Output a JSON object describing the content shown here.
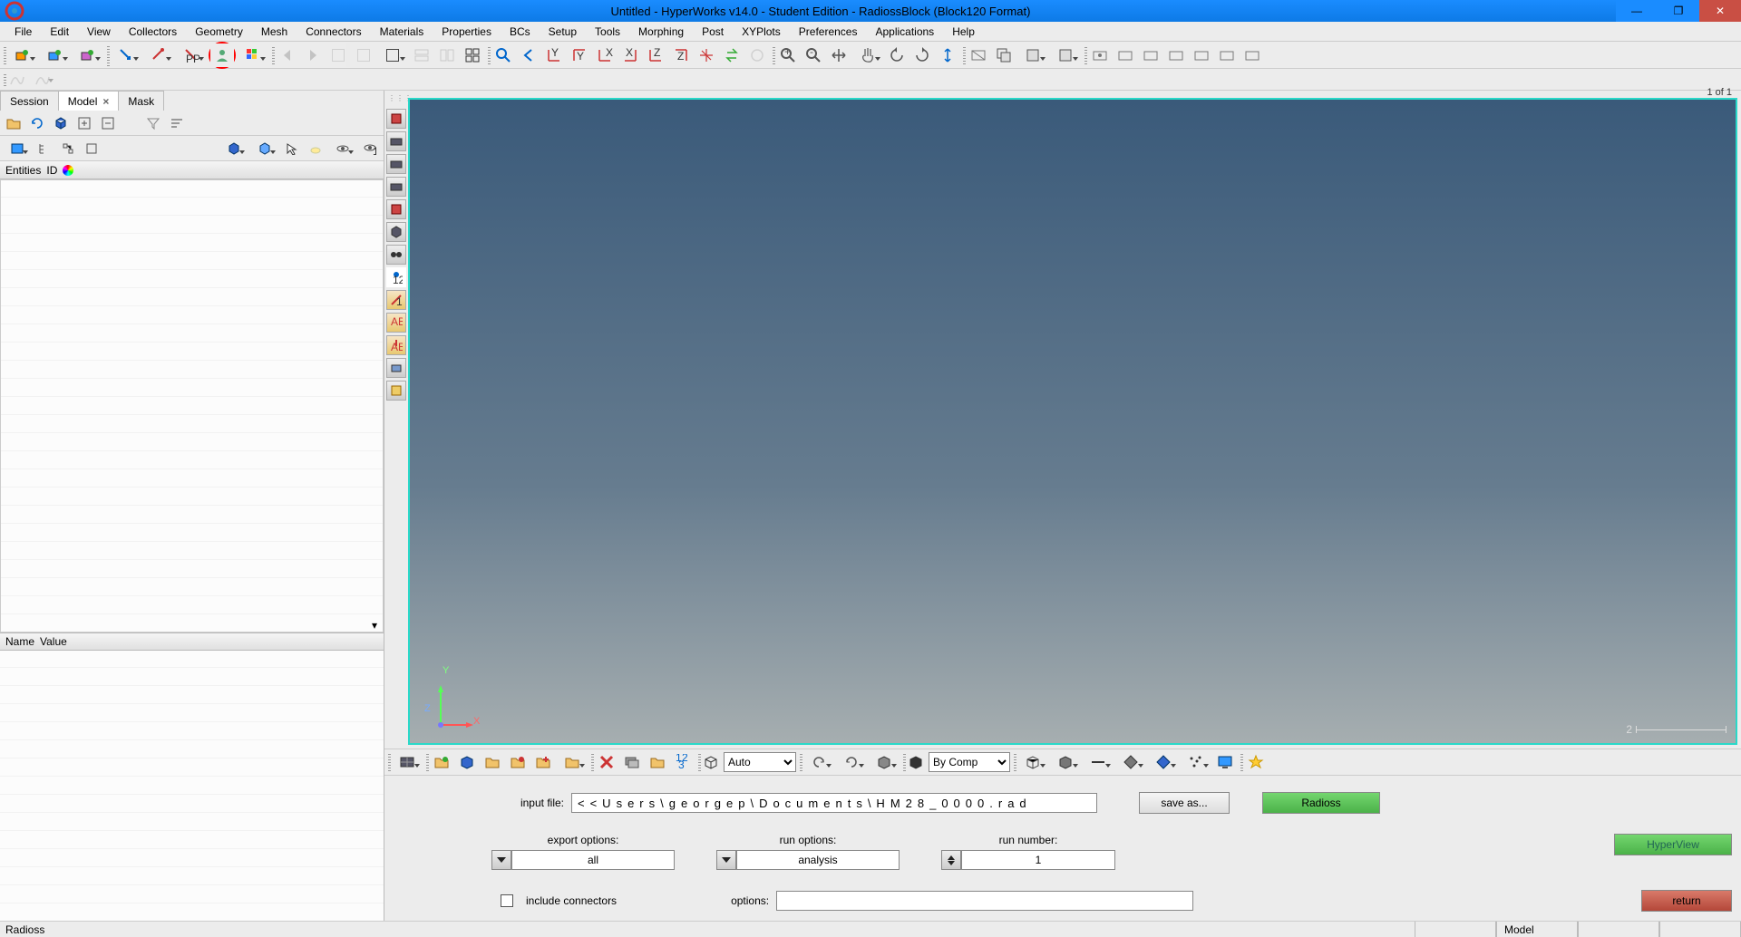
{
  "titlebar": {
    "title": "Untitled - HyperWorks v14.0 - Student Edition - RadiossBlock (Block120 Format)"
  },
  "menu": [
    "File",
    "Edit",
    "View",
    "Collectors",
    "Geometry",
    "Mesh",
    "Connectors",
    "Materials",
    "Properties",
    "BCs",
    "Setup",
    "Tools",
    "Morphing",
    "Post",
    "XYPlots",
    "Preferences",
    "Applications",
    "Help"
  ],
  "left": {
    "tabs": [
      {
        "label": "Session",
        "active": false,
        "closable": false
      },
      {
        "label": "Model",
        "active": true,
        "closable": true
      },
      {
        "label": "Mask",
        "active": false,
        "closable": false
      }
    ],
    "entities_cols": [
      "Entities",
      "ID"
    ],
    "namevalue_cols": [
      "Name",
      "Value"
    ]
  },
  "viewport": {
    "label": "1 of 1",
    "axes": {
      "x": "X",
      "y": "Y",
      "z": "Z"
    },
    "scale_value": "2"
  },
  "bottom_toolbar": {
    "auto_label": "Auto",
    "bycomp_label": "By Comp"
  },
  "form": {
    "input_file_label": "input file:",
    "input_file_value": "<<Users\\georgep\\Documents\\HM28_0000.rad",
    "save_as_label": "save as...",
    "radioss_label": "Radioss",
    "hyperview_label": "HyperView",
    "export_options_label": "export options:",
    "export_options_value": "all",
    "run_options_label": "run options:",
    "run_options_value": "analysis",
    "run_number_label": "run number:",
    "run_number_value": "1",
    "include_connectors_label": "include connectors",
    "options_label": "options:",
    "options_value": "",
    "return_label": "return"
  },
  "statusbar": {
    "left": "Radioss",
    "model": "Model"
  }
}
